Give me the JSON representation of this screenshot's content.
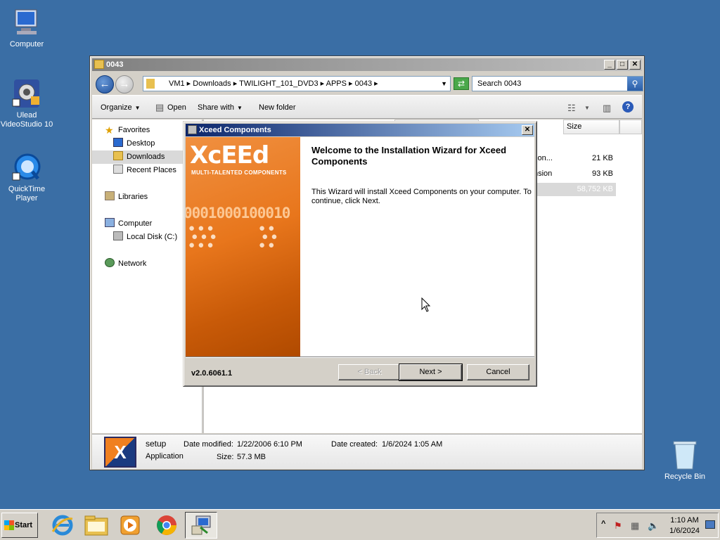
{
  "desktop": {
    "icons": [
      {
        "label": "Computer"
      },
      {
        "label": "Ulead VideoStudio 10"
      },
      {
        "label": "QuickTime Player"
      },
      {
        "label": "Recycle Bin"
      }
    ]
  },
  "explorer": {
    "title": "0043",
    "address": {
      "segments": [
        "VM1",
        "Downloads",
        "TWILIGHT_101_DVD3",
        "APPS",
        "0043"
      ],
      "text": "VM1 ▸ Downloads ▸ TWILIGHT_101_DVD3 ▸ APPS ▸ 0043 ▸"
    },
    "search_text": "Search 0043",
    "toolbar": {
      "organize": "Organize",
      "open": "Open",
      "share_with": "Share with",
      "new_folder": "New folder"
    },
    "nav": {
      "favorites": "Favorites",
      "desktop": "Desktop",
      "downloads": "Downloads",
      "recent_places": "Recent Places",
      "libraries": "Libraries",
      "computer": "Computer",
      "local_disk": "Local Disk (C:)",
      "network": "Network"
    },
    "columns": {
      "size": "Size"
    },
    "files": [
      {
        "type_fragment": "tion...",
        "size": "21 KB"
      },
      {
        "type_fragment": "nsion",
        "size": "93 KB"
      },
      {
        "type_fragment": "",
        "size": "58,752 KB"
      }
    ],
    "details": {
      "name": "setup",
      "type": "Application",
      "modified_label": "Date modified:",
      "modified_value": "1/22/2006 6:10 PM",
      "size_label": "Size:",
      "size_value": "57.3 MB",
      "created_label": "Date created:",
      "created_value": "1/6/2024 1:05 AM"
    }
  },
  "installer": {
    "title": "Xceed Components",
    "banner_logo": "XcEEd",
    "banner_tagline": "MULTI-TALENTED COMPONENTS",
    "banner_bits": "0001000100010",
    "heading": "Welcome to the Installation Wizard for Xceed Components",
    "body": "This Wizard will install Xceed Components on your computer. To continue, click Next.",
    "version": "v2.0.6061.1",
    "buttons": {
      "back": "< Back",
      "next": "Next >",
      "cancel": "Cancel"
    }
  },
  "taskbar": {
    "start": "Start",
    "clock_time": "1:10 AM",
    "clock_date": "1/6/2024"
  }
}
